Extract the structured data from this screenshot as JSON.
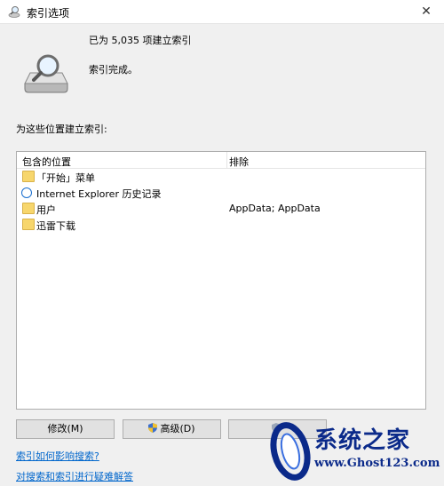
{
  "window": {
    "title": "索引选项",
    "close_glyph": "✕"
  },
  "status": {
    "count_text": "已为 5,035 项建立索引",
    "state_text": "索引完成。"
  },
  "locations_label": "为这些位置建立索引:",
  "table": {
    "columns": [
      "包含的位置",
      "排除"
    ],
    "rows": [
      {
        "icon": "folder-icon",
        "name": "「开始」菜单",
        "exclude": ""
      },
      {
        "icon": "internet-explorer-icon",
        "name": "Internet Explorer 历史记录",
        "exclude": ""
      },
      {
        "icon": "folder-icon",
        "name": "用户",
        "exclude": "AppData; AppData"
      },
      {
        "icon": "folder-icon",
        "name": "迅雷下载",
        "exclude": ""
      }
    ]
  },
  "buttons": {
    "modify": "修改(M)",
    "advanced": "高级(D)",
    "pause": ""
  },
  "links": {
    "how_affects": "索引如何影响搜索?",
    "troubleshoot": "对搜索和索引进行疑难解答"
  },
  "watermark": {
    "title": "系统之家",
    "url": "www.Ghost123.com"
  },
  "colors": {
    "link": "#0066cc",
    "folder": "#f7d66c",
    "watermark": "#0b2a8a"
  }
}
